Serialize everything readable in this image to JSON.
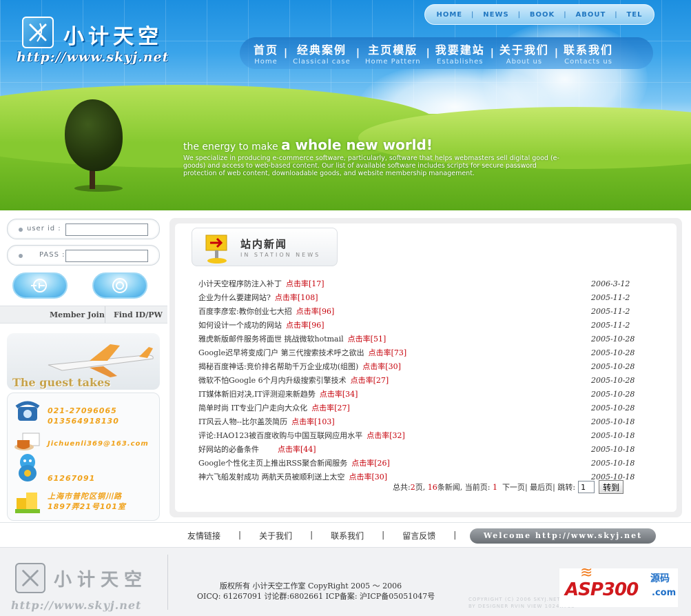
{
  "header": {
    "logo_cn": "小计天空",
    "logo_url": "http://www.skyj.net",
    "top_nav": [
      "HOME",
      "NEWS",
      "BOOK",
      "ABOUT",
      "TEL"
    ],
    "main_nav": [
      {
        "cn": "首页",
        "en": "Home"
      },
      {
        "cn": "经典案例",
        "en": "Classical case"
      },
      {
        "cn": "主页模版",
        "en": "Home Pattern"
      },
      {
        "cn": "我要建站",
        "en": "Establishes"
      },
      {
        "cn": "关于我们",
        "en": "About us"
      },
      {
        "cn": "联系我们",
        "en": "Contacts us"
      }
    ],
    "tagline_small": "the energy to make",
    "tagline_big": "a whole new world!",
    "tagline_desc": "We specialize in producing e-commerce software, particularly, software that helps webmasters sell digital good (e-goods) and access to web-based content. Our list of available software includes scripts for secure password protection of web content, downloadable goods, and website membership management."
  },
  "login": {
    "userid_label": "user id :",
    "userid_value": "",
    "pass_label": "PASS :",
    "pass_value": "",
    "member_join": "Member Join",
    "find_id_pw": "Find ID/PW"
  },
  "guest": {
    "title": "The guest takes"
  },
  "contact": {
    "phone_1": "021-27096065",
    "phone_2": "013564918130",
    "email": "Jichuenli369@163.com",
    "qq": "61267091",
    "address_1": "上海市普陀区铜川路",
    "address_2": "1897弄21号101室",
    "colors": {
      "accent": "#f0a21b"
    }
  },
  "news": {
    "title_cn": "站内新闻",
    "title_en": "IN STATION NEWS",
    "hit_label": "点击率",
    "items": [
      {
        "title": "小计天空程序防注入补丁",
        "hits": "[17]",
        "date": "2006-3-12"
      },
      {
        "title": "企业为什么要建网站?",
        "hits": "[108]",
        "date": "2005-11-2"
      },
      {
        "title": "百度李彦宏:教你创业七大招",
        "hits": "[96]",
        "date": "2005-11-2"
      },
      {
        "title": "如何设计一个成功的网站",
        "hits": "[96]",
        "date": "2005-11-2"
      },
      {
        "title": "雅虎新版邮件服务将面世 挑战微软hotmail",
        "hits": "[51]",
        "date": "2005-10-28"
      },
      {
        "title": "Google迟早将变成门户 第三代搜索技术呼之欲出",
        "hits": "[73]",
        "date": "2005-10-28"
      },
      {
        "title": "揭秘百度神话:竞价排名帮助千万企业成功(组图)",
        "hits": "[30]",
        "date": "2005-10-28"
      },
      {
        "title": "微软不怕Google 6个月内升级搜索引擎技术",
        "hits": "[27]",
        "date": "2005-10-28"
      },
      {
        "title": "IT媒体新旧对决,IT评测迎来新趋势",
        "hits": "[34]",
        "date": "2005-10-28"
      },
      {
        "title": "简单时尚 IT专业门户走向大众化",
        "hits": "[27]",
        "date": "2005-10-28"
      },
      {
        "title": "IT风云人物--比尔盖茨简历",
        "hits": "[103]",
        "date": "2005-10-18"
      },
      {
        "title": "评论:HAO123被百度收购与中国互联网应用水平",
        "hits": "[32]",
        "date": "2005-10-18"
      },
      {
        "title": "好网站的必备条件      ",
        "hits": "[44]",
        "date": "2005-10-18"
      },
      {
        "title": "Google个性化主页上推出RSS聚合新闻服务",
        "hits": "[26]",
        "date": "2005-10-18"
      },
      {
        "title": "神六飞船发射成功 两航天员被顺利送上太空",
        "hits": "[30]",
        "date": "2005-10-18"
      }
    ]
  },
  "pager": {
    "total_label": "总共:",
    "total_pages": "2",
    "pages_suffix": "页,",
    "total_news": "16",
    "news_suffix": "条新闻,",
    "current_label": "当前页:",
    "current_page": "1",
    "next": "下一页",
    "last": "最后页",
    "jump_label": "跳转:",
    "jump_value": "1",
    "go_button": "转到"
  },
  "linkbar": {
    "links": [
      "友情链接",
      "关于我们",
      "联系我们",
      "留言反馈"
    ],
    "welcome": "Welcome http://www.skyj.net"
  },
  "footer": {
    "logo_cn": "小计天空",
    "logo_url": "http://www.skyj.net",
    "copyright": "版权所有 小计天空工作室 CopyRight 2005 ～ 2006",
    "contact_line": "OICQ: 61267091 讨论群:6802661 ICP备案: 沪ICP备05051047号",
    "credit_1": "COPYRIGHT (C) 2006 SKYJ.NET",
    "credit_2": "BY DESIGNER RVIN VIEW 1024X768",
    "badge_asp": "ASP300",
    "badge_ym": "源码",
    "badge_com": ".com"
  }
}
